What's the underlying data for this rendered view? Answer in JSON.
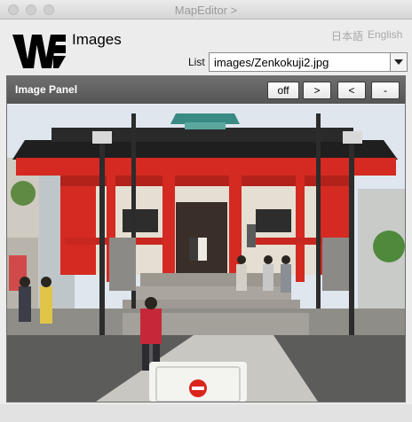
{
  "window": {
    "title": "MapEditor >"
  },
  "header": {
    "title": "Images",
    "languages": [
      "日本語",
      "English"
    ],
    "list_label": "List",
    "list_value": "images/Zenkokuji2.jpg"
  },
  "panel": {
    "title": "Image Panel",
    "buttons": [
      "off",
      ">",
      "<",
      "-"
    ]
  },
  "colors": {
    "panel_header": "#626262",
    "temple_red": "#d42a22"
  }
}
